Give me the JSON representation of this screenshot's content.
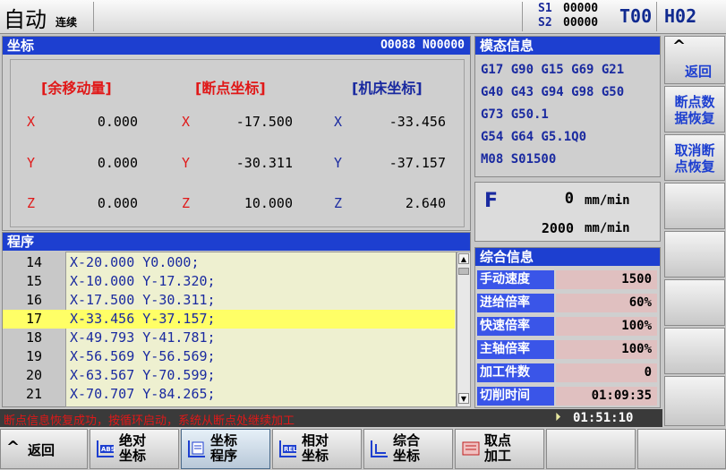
{
  "topbar": {
    "mode": "自动",
    "submode": "连续",
    "s1_label": "S1",
    "s1_value": "00000",
    "s2_label": "S2",
    "s2_value": "00000",
    "tool": "T00",
    "h": "H02"
  },
  "coords": {
    "title": "坐标",
    "program_no": "O0088 N00000",
    "col_headers": [
      "[余移动量]",
      "[断点坐标]",
      "[机床坐标]"
    ],
    "rows": [
      {
        "axis": "X",
        "remain": "0.000",
        "break": "-17.500",
        "machine": "-33.456"
      },
      {
        "axis": "Y",
        "remain": "0.000",
        "break": "-30.311",
        "machine": "-37.157"
      },
      {
        "axis": "Z",
        "remain": "0.000",
        "break": "10.000",
        "machine": "2.640"
      }
    ]
  },
  "modal": {
    "title": "模态信息",
    "lines": [
      "G17 G90 G15 G69 G21",
      "G40 G43 G94 G98 G50",
      "G73 G50.1",
      "G54 G64 G5.1Q0",
      "M08 S01500"
    ]
  },
  "feed": {
    "label": "F",
    "value": "0",
    "unit1": "mm/min",
    "value2": "2000",
    "unit2": "mm/min"
  },
  "program": {
    "title": "程序",
    "rows": [
      {
        "n": "14",
        "text": "X-20.000 Y0.000;"
      },
      {
        "n": "15",
        "text": "X-10.000 Y-17.320;"
      },
      {
        "n": "16",
        "text": "X-17.500 Y-30.311;"
      },
      {
        "n": "17",
        "text": "X-33.456 Y-37.157;"
      },
      {
        "n": "18",
        "text": "X-49.793 Y-41.781;"
      },
      {
        "n": "19",
        "text": "X-56.569 Y-56.569;"
      },
      {
        "n": "20",
        "text": "X-63.567 Y-70.599;"
      },
      {
        "n": "21",
        "text": "X-70.707 Y-84.265;"
      }
    ],
    "highlight_index": 3
  },
  "summary": {
    "title": "综合信息",
    "items": [
      {
        "label": "手动速度",
        "value": "1500"
      },
      {
        "label": "进给倍率",
        "value": "60%"
      },
      {
        "label": "快速倍率",
        "value": "100%"
      },
      {
        "label": "主轴倍率",
        "value": "100%"
      },
      {
        "label": "加工件数",
        "value": "0"
      },
      {
        "label": "切削时间",
        "value": "01:09:35"
      }
    ]
  },
  "status": {
    "message": "断点信息恢复成功，按循环启动，系统从断点处继续加工",
    "time": "01:51:10"
  },
  "side": {
    "up_arrow": "^",
    "back": "返回",
    "btn1": [
      "断点数",
      "据恢复"
    ],
    "btn2": [
      "取消断",
      "点恢复"
    ]
  },
  "bottom": {
    "back_arrow": "^",
    "back": "返回",
    "b1": [
      "绝对",
      "坐标"
    ],
    "b1_icon": "ABS",
    "b2": [
      "坐标",
      "程序"
    ],
    "b3": [
      "相对",
      "坐标"
    ],
    "b3_icon": "REL",
    "b4": [
      "综合",
      "坐标"
    ],
    "b5": [
      "取点",
      "加工"
    ]
  },
  "colors": {
    "header_blue": "#1d3fd0",
    "highlight": "#ffff66",
    "axis_red": "#e01818",
    "status_red": "#e01818"
  }
}
